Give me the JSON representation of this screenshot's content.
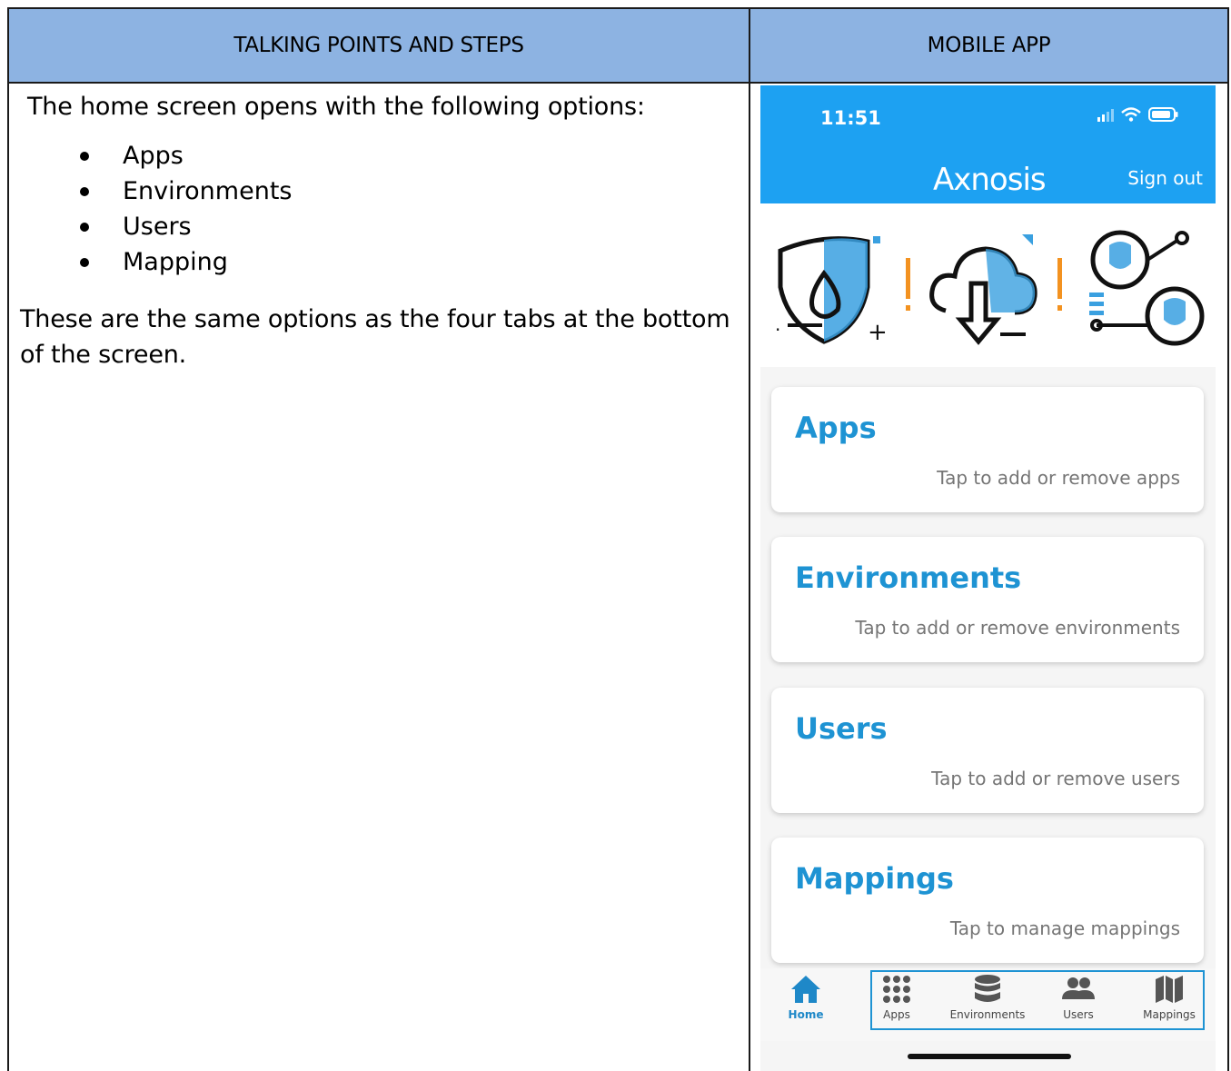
{
  "table": {
    "col1_header": "TALKING POINTS AND STEPS",
    "col2_header": "MOBILE APP"
  },
  "talking_points": {
    "intro": "The home screen opens with the following options:",
    "bullets": [
      "Apps",
      "Environments",
      "Users",
      "Mapping"
    ],
    "outro": "These are the same options as the four tabs at the bottom of the screen."
  },
  "phone": {
    "status_time": "11:51",
    "logo_text": "Axnosis",
    "sign_out": "Sign out",
    "cards": [
      {
        "title": "Apps",
        "subtitle": "Tap to add or remove apps"
      },
      {
        "title": "Environments",
        "subtitle": "Tap to add or remove environments"
      },
      {
        "title": "Users",
        "subtitle": "Tap to add or remove users"
      },
      {
        "title": "Mappings",
        "subtitle": "Tap to manage mappings"
      }
    ],
    "tabs": [
      {
        "label": "Home",
        "icon": "home-icon"
      },
      {
        "label": "Apps",
        "icon": "grid-dots-icon"
      },
      {
        "label": "Environments",
        "icon": "database-icon"
      },
      {
        "label": "Users",
        "icon": "users-icon"
      },
      {
        "label": "Mappings",
        "icon": "map-icon"
      }
    ],
    "banner_icons": [
      "shield-drop-icon",
      "cloud-download-icon",
      "user-network-icon"
    ]
  },
  "colors": {
    "header_bg": "#8db3e2",
    "app_blue": "#1da1f2",
    "card_title": "#1e93d3"
  }
}
